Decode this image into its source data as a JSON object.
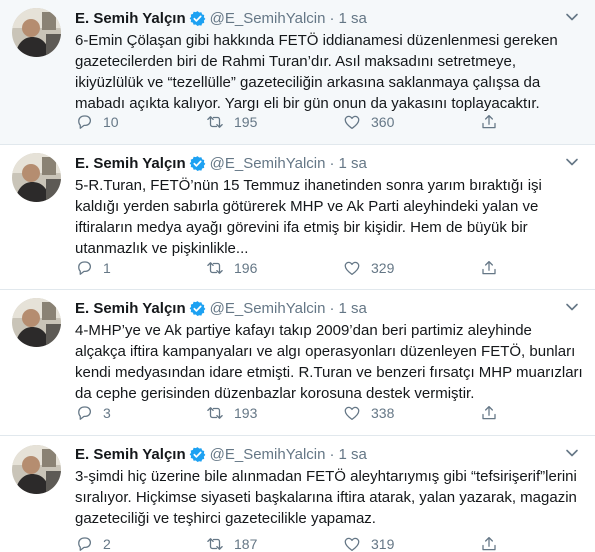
{
  "tweets": [
    {
      "name": "E. Semih Yalçın",
      "handle": "@E_SemihYalcin",
      "separator": "·",
      "time": "1 sa",
      "text": "6-Emin Çölaşan gibi hakkında FETÖ iddianamesi düzenlenmesi gereken gazetecilerden biri de Rahmi Turan’dır. Asıl maksadını setretmeye, ikiyüzlülük ve “tezellülle” gazeteciliğin arkasına saklanmaya çalışsa da mabadı açıkta kalıyor. Yargı eli bir gün onun da yakasını toplayacaktır.",
      "replies": "10",
      "retweets": "195",
      "likes": "360"
    },
    {
      "name": "E. Semih Yalçın",
      "handle": "@E_SemihYalcin",
      "separator": "·",
      "time": "1 sa",
      "text": "5-R.Turan, FETÖ’nün 15 Temmuz ihanetinden sonra yarım bıraktığı işi kaldığı yerden sabırla götürerek MHP ve Ak Parti aleyhindeki yalan ve iftiraların medya ayağı görevini ifa etmiş bir kişidir. Hem de büyük bir utanmazlık ve pişkinlikle...",
      "replies": "1",
      "retweets": "196",
      "likes": "329"
    },
    {
      "name": "E. Semih Yalçın",
      "handle": "@E_SemihYalcin",
      "separator": "·",
      "time": "1 sa",
      "text": "4-MHP’ye ve Ak partiye kafayı takıp 2009’dan beri partimiz aleyhinde alçakça iftira kampanyaları ve algı operasyonları düzenleyen FETÖ, bunları kendi medyasından idare etmişti. R.Turan ve benzeri fırsatçı MHP muarızları da cephe gerisinden düzenbazlar korosuna destek vermiştir.",
      "replies": "3",
      "retweets": "193",
      "likes": "338"
    },
    {
      "name": "E. Semih Yalçın",
      "handle": "@E_SemihYalcin",
      "separator": "·",
      "time": "1 sa",
      "text": "3-şimdi hiç üzerine bile alınmadan FETÖ aleyhtarıymış gibi “tefsirişerif”lerini sıralıyor. Hiçkimse siyaseti başkalarına iftira atarak, yalan yazarak, magazin gazeteciliği ve teşhirci gazetecilikle yapamaz.",
      "replies": "2",
      "retweets": "187",
      "likes": "319"
    }
  ],
  "colors": {
    "verified": "#1da1f2",
    "muted": "#657786",
    "text": "#14171a",
    "highlight_bg": "#f5f8fa",
    "border": "#e1e8ed"
  },
  "icons": [
    "avatar",
    "verified-badge-icon",
    "chevron-down-icon",
    "reply-icon",
    "retweet-icon",
    "like-icon",
    "share-icon"
  ]
}
